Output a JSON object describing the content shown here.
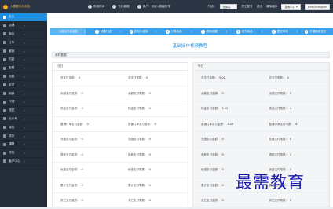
{
  "topbar": {
    "brand": "大数据分析系统",
    "nav": [
      {
        "icon": "clock-icon",
        "label": "系统时间"
      },
      {
        "icon": "cloud-icon",
        "label": "在线客服"
      },
      {
        "icon": "user-icon",
        "label": "用户：系统--超级账号"
      }
    ],
    "store_label": "门店：",
    "store_value": "全部店",
    "links": [
      "员工账号",
      "退出",
      "清除缓存"
    ],
    "pill_search": "搜索中心 ▾",
    "pill_user": "Jane/Shanghai"
  },
  "sidebar": {
    "items": [
      {
        "label": "首页",
        "arrow": "",
        "active": true
      },
      {
        "label": "店铺",
        "arrow": "›",
        "active": false
      },
      {
        "label": "商品",
        "arrow": "›",
        "active": false
      },
      {
        "label": "订单",
        "arrow": "›",
        "active": false
      },
      {
        "label": "营销",
        "arrow": "›",
        "active": false
      },
      {
        "label": "内容",
        "arrow": "›",
        "active": false
      },
      {
        "label": "客服",
        "arrow": "›",
        "active": false
      },
      {
        "label": "设置",
        "arrow": "›",
        "active": false
      },
      {
        "label": "会员",
        "arrow": "›",
        "active": false
      },
      {
        "label": "积分",
        "arrow": "›",
        "active": false
      },
      {
        "label": "代理",
        "arrow": "›",
        "active": false
      },
      {
        "label": "报表",
        "arrow": "›",
        "active": false
      },
      {
        "label": "公众号",
        "arrow": "›",
        "active": false
      },
      {
        "label": "微信",
        "arrow": "›",
        "active": false
      },
      {
        "label": "财务",
        "arrow": "›",
        "active": false
      },
      {
        "label": "课程",
        "arrow": "›",
        "active": false
      },
      {
        "label": "短信",
        "arrow": "›",
        "active": false
      },
      {
        "label": "客户中心",
        "arrow": "›",
        "active": false
      }
    ]
  },
  "steps": [
    {
      "num": "",
      "label": "小程序开通流程"
    },
    {
      "num": "1",
      "label": "创建门店"
    },
    {
      "num": "2",
      "label": "授权小程序"
    },
    {
      "num": "3",
      "label": "分类商品"
    },
    {
      "num": "4",
      "label": "基础设置"
    },
    {
      "num": "5",
      "label": "发布商品"
    },
    {
      "num": "6",
      "label": "提交审核"
    },
    {
      "num": "7",
      "label": "开通微信支付"
    }
  ],
  "page_title": "基础操作视频教程",
  "section_label": "实时数据",
  "left_panel": {
    "title": "今日",
    "rows": [
      [
        {
          "k": "总支付金额：",
          "v": "0"
        },
        {
          "k": "总支付笔数：",
          "v": "0"
        }
      ],
      [
        {
          "k": "余额支付金额：",
          "v": "0"
        },
        {
          "k": "余额支付笔数：",
          "v": "0"
        }
      ],
      [
        {
          "k": "现金支付金额：",
          "v": "0"
        },
        {
          "k": "现金支付笔数：",
          "v": "0"
        }
      ],
      [
        {
          "k": "普通订单支付金额：",
          "v": "0"
        },
        {
          "k": "普通订单支付笔数：",
          "v": "0"
        }
      ],
      [
        {
          "k": "充值支付金额：",
          "v": "0"
        },
        {
          "k": "充值支付笔数：",
          "v": "0"
        }
      ],
      [
        {
          "k": "退款支付金额：",
          "v": "0"
        },
        {
          "k": "退款支付笔数：",
          "v": "0"
        }
      ],
      [
        {
          "k": "优惠支付金额：",
          "v": "0"
        },
        {
          "k": "优惠支付笔数：",
          "v": "0"
        }
      ],
      [
        {
          "k": "累计支付金额：",
          "v": "0"
        },
        {
          "k": "累计支付笔数：",
          "v": "0"
        }
      ],
      [
        {
          "k": "其它支付金额：",
          "v": "0"
        },
        {
          "k": "其它支付笔数：",
          "v": "0"
        }
      ]
    ]
  },
  "right_panel": {
    "title": "昨日",
    "rows": [
      [
        {
          "k": "总支付金额：",
          "v": "5.02"
        },
        {
          "k": "总支付笔数：",
          "v": "4"
        }
      ],
      [
        {
          "k": "余额支付金额：",
          "v": "0"
        },
        {
          "k": "余额支付笔数：",
          "v": "0"
        }
      ],
      [
        {
          "k": "现金支付金额：",
          "v": "5.02"
        },
        {
          "k": "现金支付笔数：",
          "v": "4"
        }
      ],
      [
        {
          "k": "普通订单支付金额：",
          "v": "5.02"
        },
        {
          "k": "普通订单支付笔数：",
          "v": "4"
        }
      ],
      [
        {
          "k": "充值支付金额：",
          "v": "0"
        },
        {
          "k": "充值支付笔数：",
          "v": "0"
        }
      ],
      [
        {
          "k": "退款支付金额：",
          "v": "0"
        },
        {
          "k": "退款支付笔数：",
          "v": "2"
        }
      ],
      [
        {
          "k": "优惠支付金额：",
          "v": "0"
        },
        {
          "k": "优惠支付笔数：",
          "v": "0"
        }
      ],
      [
        {
          "k": "累计支付金额：",
          "v": "0"
        },
        {
          "k": "累计支付笔数：",
          "v": "0"
        }
      ],
      [
        {
          "k": "其它支付金额：",
          "v": "0"
        },
        {
          "k": "其它支付笔数：",
          "v": "0"
        }
      ]
    ]
  },
  "watermark": "最需教育"
}
